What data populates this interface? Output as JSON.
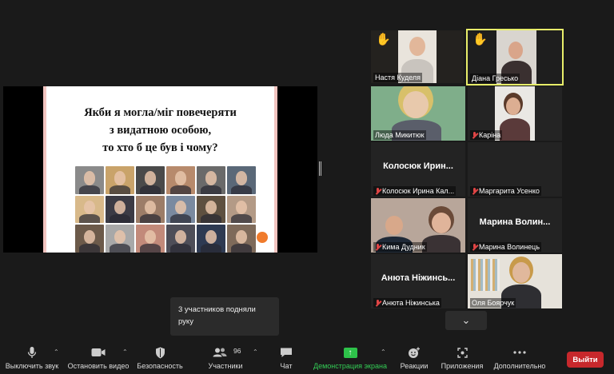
{
  "slide": {
    "title_line1": "Якби я могла/міг повечеряти",
    "title_line2": "з видатною особою,",
    "title_line3": "то хто б це був і чому?"
  },
  "participants": [
    {
      "name": "Настя Куделя",
      "hand": true,
      "muted": false
    },
    {
      "name": "Діана Гресько",
      "hand": true,
      "muted": false,
      "active": true
    },
    {
      "name": "Люда Микитюк",
      "muted": false
    },
    {
      "name": "Каріна",
      "muted": true
    },
    {
      "name": "Колосюк Ирина Кал...",
      "display": "Колосюк Ирин...",
      "muted": true
    },
    {
      "name": "Маргарита Усенко",
      "muted": true
    },
    {
      "name": "Кима Дудник",
      "muted": true
    },
    {
      "name": "Марина Волинець",
      "display": "Марина Волин...",
      "muted": true
    },
    {
      "name": "Анюта Ніжинська",
      "display": "Анюта Ніжинсь...",
      "muted": true
    },
    {
      "name": "Оля Боярчук",
      "muted": false
    }
  ],
  "tooltip": {
    "text": "3 участников подняли руку"
  },
  "toolbar": {
    "mute": "Выключить звук",
    "video": "Остановить видео",
    "security": "Безопасность",
    "participants": "Участники",
    "participants_count": "96",
    "chat": "Чат",
    "share": "Демонстрация экрана",
    "reactions": "Реакции",
    "apps": "Приложения",
    "more": "Дополнительно",
    "leave": "Выйти"
  },
  "colors": {
    "accent_green": "#2ec24a",
    "leave_red": "#c7282c",
    "active_border": "#e8ee6a",
    "raised_hand": "#f5c518"
  }
}
